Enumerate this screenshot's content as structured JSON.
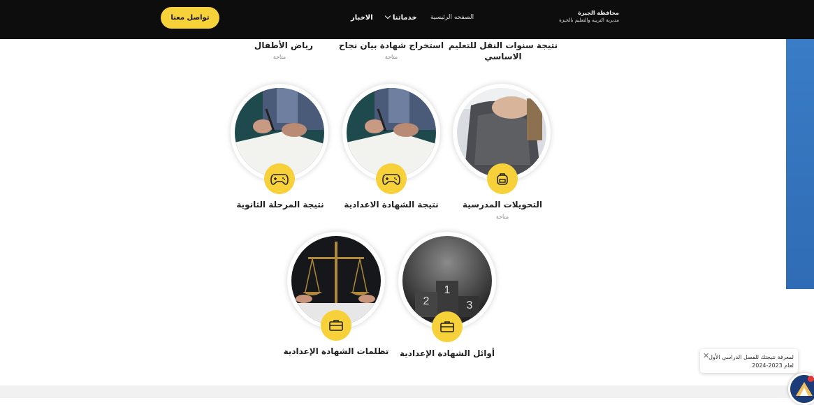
{
  "header": {
    "contact_button": "تواصل معنا",
    "nav": {
      "news": "الاخبار",
      "services": "خدماتنا",
      "home": "الصفحه الرئيسية"
    },
    "brand": {
      "line1": "محافظة الجيزة",
      "line2": "مديرية التربيه والتعليم بالجيزة"
    }
  },
  "top_row": [
    {
      "title": "رياض الأطفال",
      "status": "متاحة"
    },
    {
      "title": "استخراج شهادة بيان نجاح",
      "status": "متاحة"
    },
    {
      "title": "نتيجة سنوات النقل للتعليم الاساسي",
      "status": ""
    }
  ],
  "middle_row": [
    {
      "title": "نتيجة المرحلة الثانوية",
      "icon": "gamepad-icon"
    },
    {
      "title": "نتيجة الشهادة الاعدادية",
      "icon": "gamepad-icon"
    },
    {
      "title": "التحويلات المدرسية",
      "status": "متاحة",
      "icon": "backpack-icon"
    }
  ],
  "bottom_row": [
    {
      "title": "تظلمات الشهادة الإعدادية",
      "icon": "briefcase-icon"
    },
    {
      "title": "أوائل الشهادة الإعدادية",
      "icon": "briefcase-icon"
    }
  ],
  "toast": {
    "text": "لمعرفة نتيجتك للفصل الدراسي الأول لعام 2023-2024",
    "close": "✕"
  },
  "colors": {
    "accent": "#f7d13a",
    "header": "#0d0d0d",
    "band": "#2f6cb5"
  }
}
